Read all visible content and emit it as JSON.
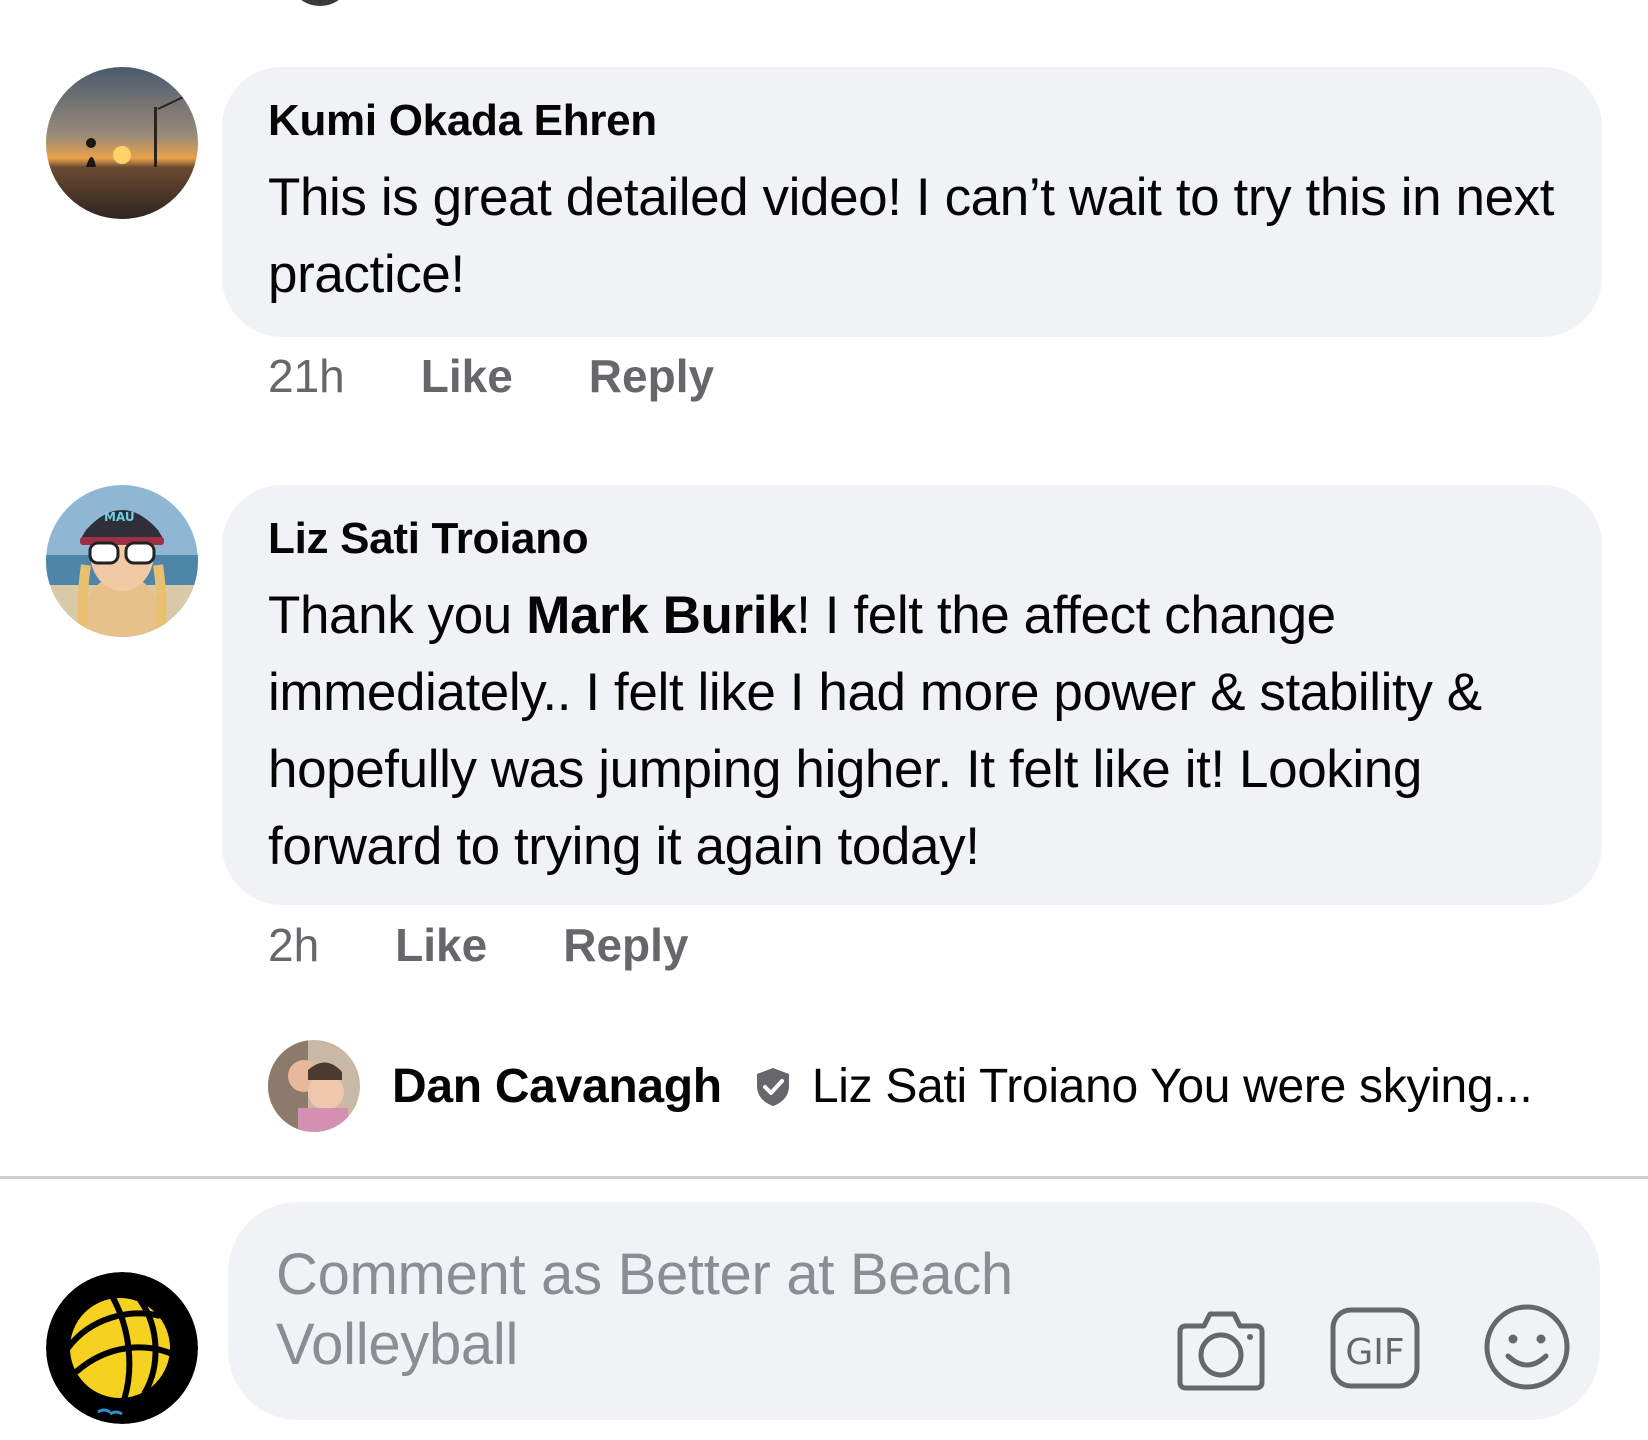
{
  "comments": [
    {
      "author": "Kumi Okada Ehren",
      "text": "This is great detailed video! I can’t wait to try this in next practice!",
      "time": "21h",
      "like_label": "Like",
      "reply_label": "Reply"
    },
    {
      "author": "Liz Sati Troiano",
      "text_before": "Thank you ",
      "mention": "Mark Burik",
      "text_after": "! I felt the affect change immediately.. I felt like I had more power & stability & hopefully was jumping higher. It felt like it! Looking forward to trying it again today!",
      "time": "2h",
      "like_label": "Like",
      "reply_label": "Reply",
      "cap_text": "MAU"
    }
  ],
  "reply_preview": {
    "author": "Dan Cavanagh",
    "text": "Liz Sati Troiano You were skying...",
    "badge_icon": "verified-shield-icon"
  },
  "composer": {
    "placeholder": "Comment as Better at Beach Volleyball",
    "tools": [
      "camera-icon",
      "gif-icon",
      "emoji-icon"
    ],
    "gif_label": "GIF"
  },
  "colors": {
    "bubble": "#f0f2f5",
    "secondary_text": "#65676b",
    "placeholder": "#8a8d91",
    "logo_yellow": "#f5d21f"
  }
}
